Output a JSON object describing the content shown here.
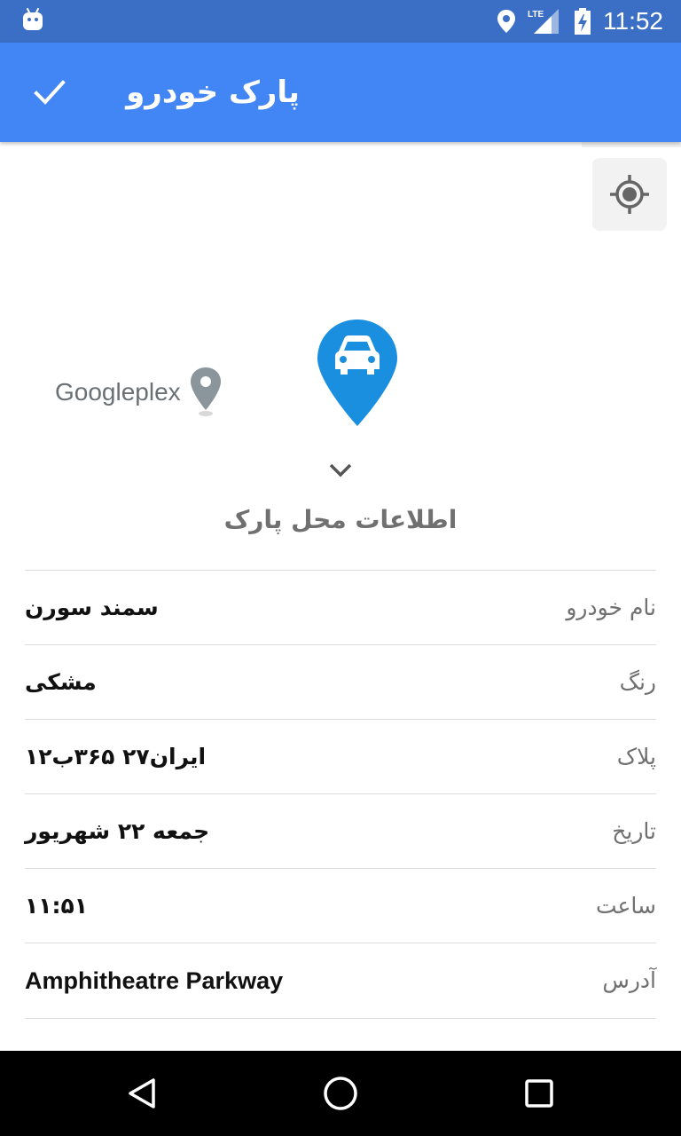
{
  "status_bar": {
    "time": "11:52",
    "network_label": "LTE",
    "icons": [
      "android-icon",
      "location-icon",
      "lte-signal-icon",
      "battery-charging-icon"
    ]
  },
  "app_bar": {
    "title": "پارک خودرو",
    "confirm_icon": "check-icon",
    "background_color": "#4285f4"
  },
  "map": {
    "place_label": "Googleplex",
    "marker_icon": "car-marker-icon",
    "marker_color": "#1a8fe0",
    "my_location_icon": "my-location-icon"
  },
  "details": {
    "collapse_icon": "chevron-down-icon",
    "title": "اطلاعات محل پارک",
    "rows": [
      {
        "label": "نام خودرو",
        "value": "سمند سورن"
      },
      {
        "label": "رنگ",
        "value": "مشکی"
      },
      {
        "label": "پلاک",
        "value": "ایران۲۷ ۳۶۵ب۱۲"
      },
      {
        "label": "تاریخ",
        "value": "جمعه ۲۲ شهریور"
      },
      {
        "label": "ساعت",
        "value": "۱۱:۵۱"
      },
      {
        "label": "آدرس",
        "value": "Amphitheatre Parkway"
      }
    ]
  },
  "nav_bar": {
    "icons": [
      "back-icon",
      "home-icon",
      "recents-icon"
    ]
  }
}
